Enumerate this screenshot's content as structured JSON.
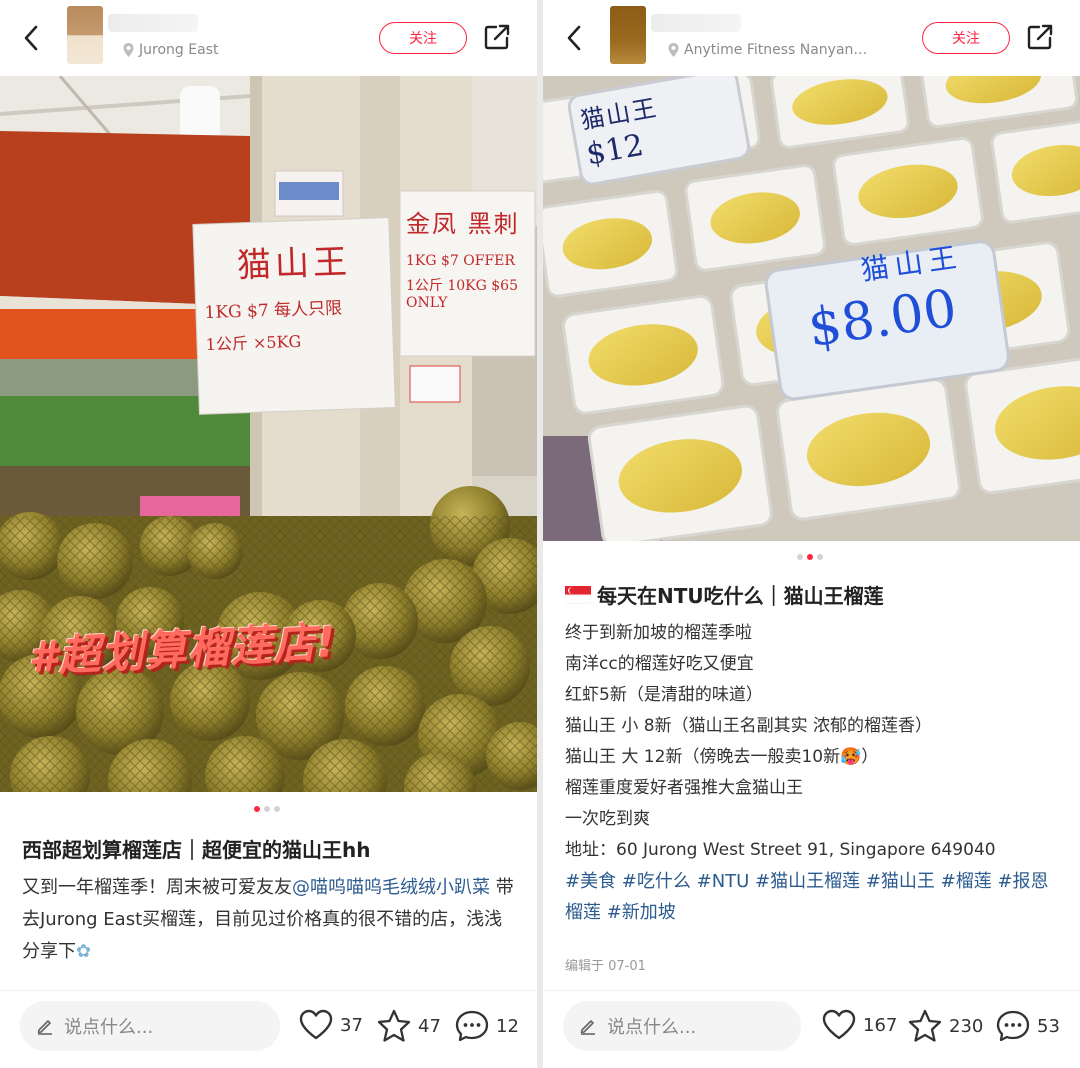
{
  "left": {
    "location": "Jurong East",
    "follow_label": "关注",
    "overlay_text": "#超划算榴莲店!",
    "sign1": {
      "l1": "猫山王",
      "l2": "1KG $7 每人只限",
      "l3": "1公斤 ×5KG"
    },
    "sign2": {
      "l1": "金凤 黑刺",
      "l2": "1KG $7 OFFER",
      "l3": "1公斤 10KG $65 ONLY"
    },
    "title": "西部超划算榴莲店｜超便宜的猫山王hh",
    "body_prefix": "又到一年榴莲季！周末被可爱友友",
    "mention": "@喵呜喵呜毛绒绒小趴菜",
    "body_suffix": " 带去Jurong East买榴莲，目前见过价格真的很不错的店，浅浅分享下",
    "comment_placeholder": "说点什么...",
    "likes": "37",
    "stars": "47",
    "comments": "12",
    "active_dot": 0
  },
  "right": {
    "location": "Anytime Fitness Nanyan…",
    "follow_label": "关注",
    "sign1": {
      "l1": "猫山王",
      "l2": "$12"
    },
    "sign2": {
      "l1": "猫山王",
      "l2": "$8.00"
    },
    "title": "每天在NTU吃什么｜猫山王榴莲",
    "lines": [
      "终于到新加坡的榴莲季啦",
      "南洋cc的榴莲好吃又便宜",
      "红虾5新（是清甜的味道）",
      "猫山王 小 8新（猫山王名副其实 浓郁的榴莲香）",
      "猫山王 大 12新（傍晚去一般卖10新🥵）",
      "榴莲重度爱好者强推大盒猫山王",
      "一次吃到爽",
      "地址：60 Jurong West Street 91, Singapore 649040"
    ],
    "tags": "#美食 #吃什么 #NTU #猫山王榴莲 #猫山王 #榴莲 #报恩榴莲 #新加坡",
    "edit_date": "编辑于 07-01",
    "comment_placeholder": "说点什么...",
    "likes": "167",
    "stars": "230",
    "comments": "53",
    "active_dot": 1
  },
  "colors": {
    "accent": "#ff2442",
    "link": "#2c5b8f"
  },
  "icons": [
    "back-icon",
    "location-icon",
    "share-icon",
    "pencil-icon",
    "heart-icon",
    "star-icon",
    "comment-icon",
    "singapore-flag-icon",
    "sparkle-emoji-icon"
  ]
}
